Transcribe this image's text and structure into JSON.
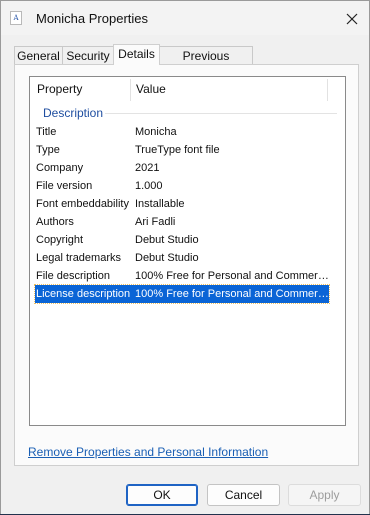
{
  "window": {
    "title": "Monicha Properties",
    "icon_glyph": "A",
    "close_icon": "close-icon"
  },
  "tabs": [
    {
      "label": "General",
      "active": false
    },
    {
      "label": "Security",
      "active": false
    },
    {
      "label": "Details",
      "active": true
    },
    {
      "label": "Previous Versions",
      "active": false
    }
  ],
  "details": {
    "columns": {
      "property": "Property",
      "value": "Value"
    },
    "group": "Description",
    "rows": [
      {
        "property": "Title",
        "value": "Monicha",
        "selected": false
      },
      {
        "property": "Type",
        "value": "TrueType font file",
        "selected": false
      },
      {
        "property": "Company",
        "value": "2021",
        "selected": false
      },
      {
        "property": "File version",
        "value": "1.000",
        "selected": false
      },
      {
        "property": "Font embeddability",
        "value": "Installable",
        "selected": false
      },
      {
        "property": "Authors",
        "value": "Ari Fadli",
        "selected": false
      },
      {
        "property": "Copyright",
        "value": "Debut Studio",
        "selected": false
      },
      {
        "property": "Legal trademarks",
        "value": "Debut Studio",
        "selected": false
      },
      {
        "property": "File description",
        "value": "100% Free for Personal and Commerc...",
        "selected": false
      },
      {
        "property": "License description",
        "value": "100% Free for Personal and Commerc...",
        "selected": true
      }
    ]
  },
  "link_remove": "Remove Properties and Personal Information",
  "buttons": {
    "ok": "OK",
    "cancel": "Cancel",
    "apply": "Apply"
  },
  "colors": {
    "selection": "#0a64d6",
    "link": "#1a5fb4",
    "group_label": "#1f4ea0"
  }
}
